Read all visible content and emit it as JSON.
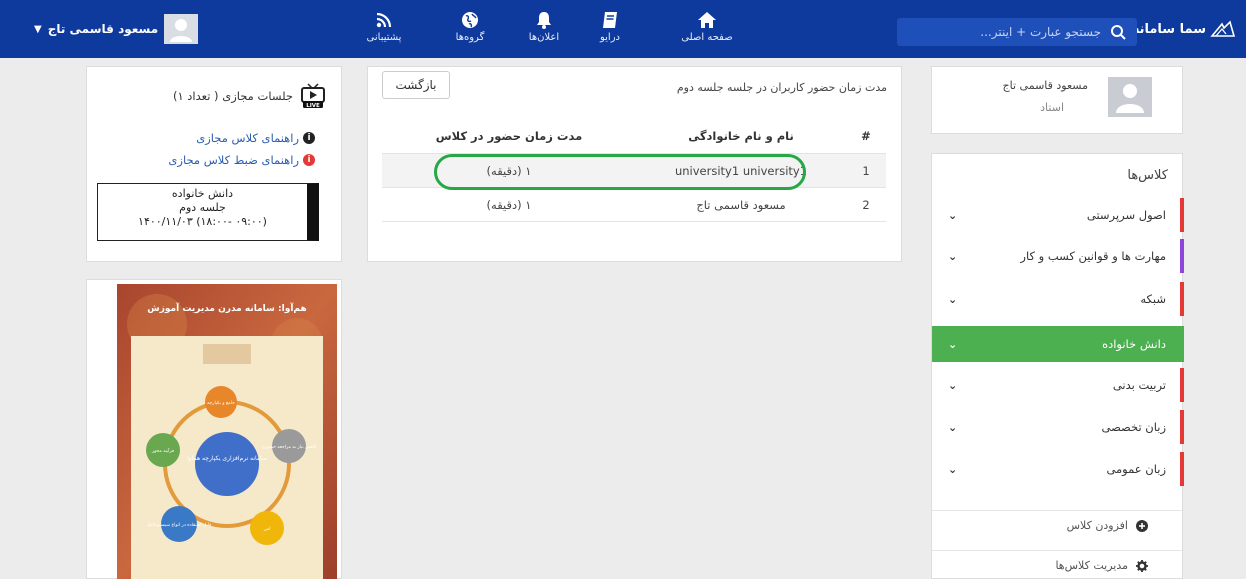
{
  "topbar": {
    "brand": "سما سامانه",
    "search_placeholder": "جستجو عبارت + اینتر...",
    "nav": [
      {
        "label": "صفحه اصلی",
        "icon": "home-icon"
      },
      {
        "label": "درایو",
        "icon": "drive-icon"
      },
      {
        "label": "اعلان‌ها",
        "icon": "bell-icon"
      },
      {
        "label": "گروه‌ها",
        "icon": "globe-icon"
      },
      {
        "label": "پشتیبانی",
        "icon": "rss-icon"
      }
    ],
    "user_name": "مسعود قاسمی تاج"
  },
  "profile": {
    "name": "مسعود قاسمی تاج",
    "role": "استاد"
  },
  "classes": {
    "title": "کلاس‌ها",
    "items": [
      {
        "label": "اصول سرپرستی",
        "color": "#e53935"
      },
      {
        "label": "مهارت ها و قوانین کسب و کار",
        "color": "#8e44dd"
      },
      {
        "label": "شبکه",
        "color": "#e53935"
      },
      {
        "label": "دانش خانواده",
        "color": "#4caf50",
        "active": true
      },
      {
        "label": "تربیت بدنی",
        "color": "#e53935"
      },
      {
        "label": "زبان تخصصی",
        "color": "#e53935"
      },
      {
        "label": "زبان عمومی",
        "color": "#e53935"
      }
    ],
    "add_class": "افزودن کلاس",
    "manage_classes": "مدیریت کلاس‌ها"
  },
  "attendance": {
    "title": "مدت زمان حضور کاربران در جلسه جلسه دوم",
    "back_label": "بازگشت",
    "columns": [
      "#",
      "نام و نام خانوادگی",
      "مدت زمان حضور در کلاس"
    ],
    "rows": [
      {
        "num": "1",
        "name": "university1 university1",
        "duration": "۱ (دقیقه)"
      },
      {
        "num": "2",
        "name": "مسعود قاسمی تاج",
        "duration": "۱ (دقیقه)"
      }
    ]
  },
  "sessions": {
    "title": "جلسات مجازی ( تعداد ۱)",
    "live_badge": "LIVE",
    "guide_class": "راهنمای کلاس مجازی",
    "guide_record": "راهنمای ضبط کلاس مجازی",
    "box_course": "دانش خانواده",
    "box_session": "جلسه دوم",
    "box_time": "۱۴۰۰/۱۱/۰۳ (۱۸:۰۰- ۰۹:۰۰)"
  },
  "poster": {
    "headline": "هم‌آوا: سامانه مدرن مدیریت آموزش",
    "center": "سامانه نرم‌افزاری یکپارچه هماوا",
    "nodes": [
      "جامع و یکپارچه",
      "کاهش نیاز به مراجعه حضوری",
      "امن",
      "قابل استفاده در انواع سیستم‌عامل",
      "فرآیند محور"
    ]
  }
}
